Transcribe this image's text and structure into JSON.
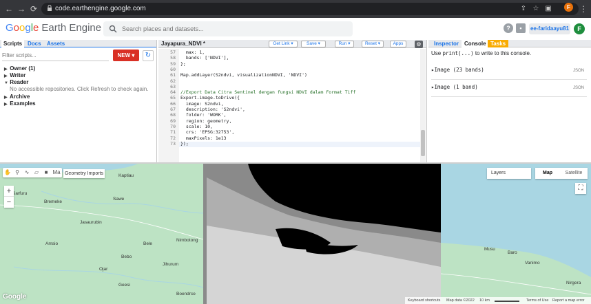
{
  "browser": {
    "url": "code.earthengine.google.com",
    "profile_initial": "F"
  },
  "header": {
    "logo_google": [
      "G",
      "o",
      "o",
      "g",
      "l",
      "e"
    ],
    "logo_product": "Earth Engine",
    "search_placeholder": "Search places and datasets...",
    "user": "ee-faridaayu81",
    "help_icon": "?",
    "avatar_initial": "F"
  },
  "left_panel": {
    "tabs": [
      "Scripts",
      "Docs",
      "Assets"
    ],
    "filter_placeholder": "Filter scripts...",
    "new_label": "NEW",
    "tree": [
      {
        "label": "Owner (1)",
        "arrow": "▶"
      },
      {
        "label": "Writer",
        "arrow": "▶"
      },
      {
        "label": "Reader",
        "arrow": "▼"
      }
    ],
    "reader_note": "No accessible repositories. Click Refresh to check again.",
    "tree2": [
      {
        "label": "Archive",
        "arrow": "▶"
      },
      {
        "label": "Examples",
        "arrow": "▶"
      }
    ]
  },
  "editor": {
    "title": "Jayapura_NDVI *",
    "buttons": {
      "get_link": "Get Link",
      "save": "Save",
      "run": "Run",
      "reset": "Reset",
      "apps": "Apps"
    },
    "line_numbers": [
      "57",
      "58",
      "59",
      "60",
      "61",
      "62",
      "63",
      "64",
      "65",
      "66",
      "67",
      "68",
      "69",
      "70",
      "71",
      "72",
      "73"
    ],
    "lines": [
      "  max: 1,",
      "  bands: ['NDVI'],",
      "};",
      "",
      "Map.addLayer(S2ndvi, visualizationNDVI, 'NDVI')",
      "",
      "",
      "//Export Data Citra Sentinel dengan fungsi NDVI dalam Format Tiff",
      "Export.image.toDrive({",
      "  image: S2ndvi,",
      "  description: 'S2ndvi',",
      "  folder: 'WORK',",
      "  region: geometry,",
      "  scale: 10,",
      "  crs: 'EPSG:32753',",
      "  maxPixels: 1e13",
      "});"
    ]
  },
  "right_panel": {
    "tabs": [
      "Inspector",
      "Console",
      "Tasks"
    ],
    "hint_prefix": "Use ",
    "hint_code": "print(...)",
    "hint_suffix": " to write to this console.",
    "rows": [
      {
        "label": "Image (23 bands)",
        "tag": "JSON"
      },
      {
        "label": "Image (1 band)",
        "tag": "JSON"
      }
    ]
  },
  "map": {
    "geometry_imports": "Geometry Imports",
    "layers": "Layers",
    "map_type_selected": "Map",
    "map_type_other": "Satellite",
    "ma_label": "Ma",
    "places": [
      {
        "name": "Kaptiau"
      },
      {
        "name": "Sarfuru"
      },
      {
        "name": "Sawe"
      },
      {
        "name": "Bremeke"
      },
      {
        "name": "Jasaurubin"
      },
      {
        "name": "Amsio"
      },
      {
        "name": "Bele"
      },
      {
        "name": "Nimbotong"
      },
      {
        "name": "Bebo"
      },
      {
        "name": "Ojar"
      },
      {
        "name": "Jihurum"
      },
      {
        "name": "Geesi"
      },
      {
        "name": "Boendrce"
      },
      {
        "name": "Musu"
      },
      {
        "name": "Baro"
      },
      {
        "name": "Vanimo"
      },
      {
        "name": "Nirgera"
      }
    ],
    "google_logo": "Google",
    "attribution": {
      "shortcuts": "Keyboard shortcuts",
      "data": "Map data ©2022",
      "scale": "10 km",
      "terms": "Terms of Use",
      "report": "Report a map error"
    },
    "colors": {
      "water": "#a9d6e3",
      "land": "#bde3c4",
      "black_mask": "#000000"
    }
  }
}
